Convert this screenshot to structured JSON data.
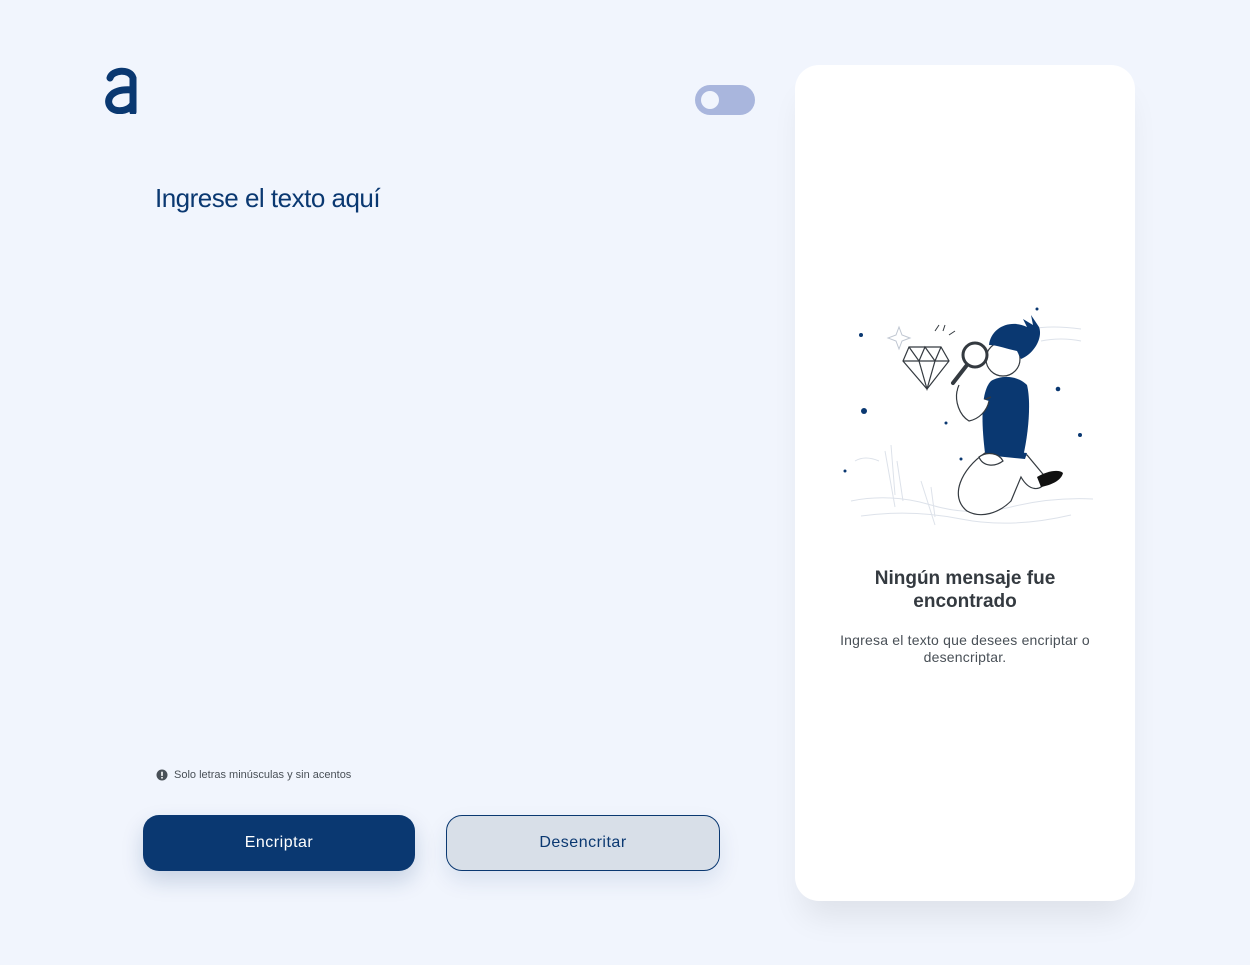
{
  "header": {
    "logo_icon": "alura-a-logo-icon",
    "theme_toggle_icon": "toggle-switch-icon"
  },
  "input": {
    "placeholder": "Ingrese el texto aquí",
    "value": ""
  },
  "hint": {
    "icon": "exclamation-circle-icon",
    "text": "Solo letras minúsculas y sin acentos"
  },
  "actions": {
    "encrypt_label": "Encriptar",
    "decrypt_label": "Desencritar"
  },
  "output_panel": {
    "illustration": "person-with-magnifying-glass-illustration",
    "title": "Ningún mensaje fue encontrado",
    "subtitle": "Ingresa el texto que desees encriptar o desencriptar."
  },
  "colors": {
    "background": "#F1F5FD",
    "primary": "#0A3871",
    "toggle": "#A9B6DD",
    "secondary_button": "#D8DFE8",
    "panel": "#FFFFFF"
  }
}
